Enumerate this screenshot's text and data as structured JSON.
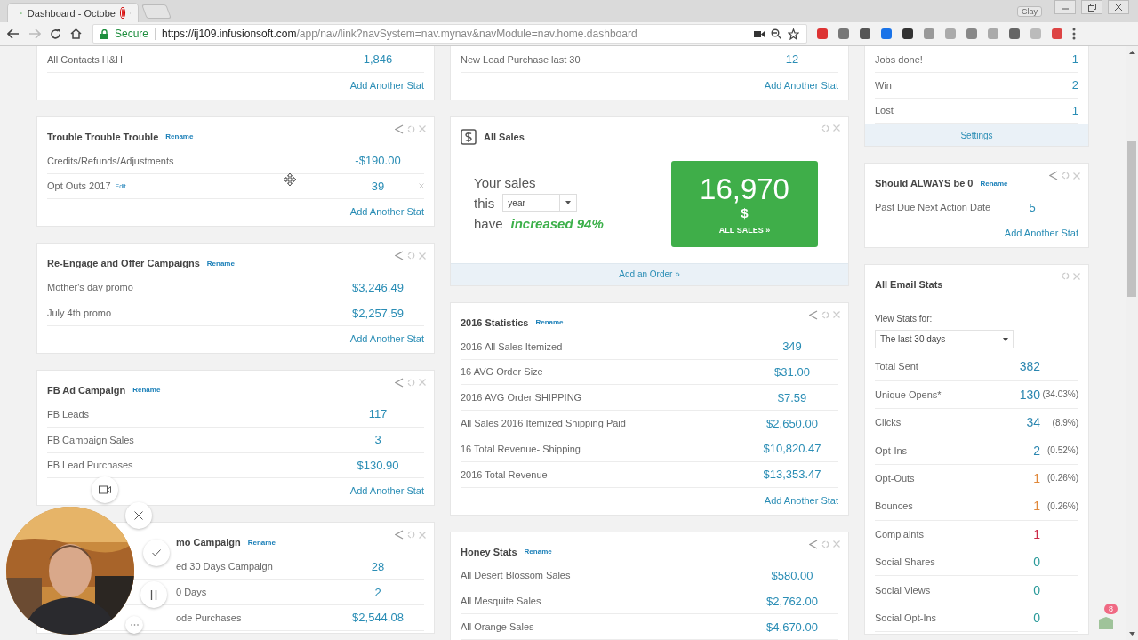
{
  "browser": {
    "tab": {
      "title": "Dashboard - Octobe",
      "recording": true
    },
    "profile": "Clay",
    "secure_label": "Secure",
    "url_host": "https://ij109.infusionsoft.com",
    "url_path": "/app/nav/link?navSystem=nav.mynav&navModule=nav.home.dashboard"
  },
  "columns": [
    {
      "cards": [
        {
          "kind": "stats",
          "rows": [
            {
              "label": "All Contacts H&H",
              "value": "1,846"
            }
          ],
          "add_stat": "Add Another Stat"
        },
        {
          "kind": "stats",
          "title": "Trouble Trouble Trouble",
          "rename": "Rename",
          "shareable": true,
          "rows": [
            {
              "label": "Credits/Refunds/Adjustments",
              "value": "-$190.00",
              "removable": false
            },
            {
              "label": "Opt Outs 2017",
              "edit": "Edit",
              "value": "39",
              "removable": true
            }
          ],
          "add_stat": "Add Another Stat"
        },
        {
          "kind": "stats",
          "title": "Re-Engage and Offer Campaigns",
          "rename": "Rename",
          "shareable": true,
          "rows": [
            {
              "label": "Mother's day promo",
              "value": "$3,246.49"
            },
            {
              "label": "July 4th promo",
              "value": "$2,257.59"
            }
          ],
          "add_stat": "Add Another Stat"
        },
        {
          "kind": "stats",
          "title": "FB Ad Campaign",
          "rename": "Rename",
          "shareable": true,
          "rows": [
            {
              "label": "FB Leads",
              "value": "117"
            },
            {
              "label": "FB Campaign Sales",
              "value": "3"
            },
            {
              "label": "FB Lead Purchases",
              "value": "$130.90"
            }
          ],
          "add_stat": "Add Another Stat"
        },
        {
          "kind": "stats",
          "title": "mo Campaign",
          "rename": "Rename",
          "shareable": true,
          "covered": true,
          "rows": [
            {
              "label": "ed 30 Days Campaign",
              "value": "28"
            },
            {
              "label": "0 Days",
              "value": "2"
            },
            {
              "label": "ode Purchases",
              "value": "$2,544.08"
            }
          ]
        }
      ]
    },
    {
      "cards": [
        {
          "kind": "stats",
          "rows": [
            {
              "label": "New Lead Purchase last 30",
              "value": "12"
            }
          ],
          "add_stat": "Add Another Stat"
        },
        {
          "kind": "sales",
          "title": "All Sales",
          "line_1": "Your sales",
          "line_2": "this",
          "period": "year",
          "line_3": "have",
          "trend": "increased 94%",
          "total": "16,970",
          "currency": "$",
          "all_sales": "ALL SALES »",
          "footer": "Add an Order »"
        },
        {
          "kind": "stats",
          "title": "2016 Statistics",
          "rename": "Rename",
          "shareable": true,
          "rows": [
            {
              "label": "2016 All Sales Itemized",
              "value": "349"
            },
            {
              "label": "16 AVG Order Size",
              "value": "$31.00"
            },
            {
              "label": "2016 AVG Order SHIPPING",
              "value": "$7.59"
            },
            {
              "label": "All Sales 2016 Itemized Shipping Paid",
              "value": "$2,650.00"
            },
            {
              "label": "16 Total Revenue- Shipping",
              "value": "$10,820.47"
            },
            {
              "label": "2016 Total Revenue",
              "value": "$13,353.47"
            }
          ],
          "add_stat": "Add Another Stat"
        },
        {
          "kind": "stats",
          "title": "Honey Stats",
          "rename": "Rename",
          "shareable": true,
          "rows": [
            {
              "label": "All Desert Blossom Sales",
              "value": "$580.00"
            },
            {
              "label": "All Mesquite Sales",
              "value": "$2,762.00"
            },
            {
              "label": "All Orange Sales",
              "value": "$4,670.00"
            }
          ]
        }
      ]
    },
    {
      "cards": [
        {
          "kind": "tally",
          "rows": [
            {
              "label": "Jobs done!",
              "value": "1"
            },
            {
              "label": "Win",
              "value": "2"
            },
            {
              "label": "Lost",
              "value": "1"
            }
          ],
          "footer": "Settings"
        },
        {
          "kind": "stats",
          "title": "Should ALWAYS be 0",
          "rename": "Rename",
          "shareable": true,
          "rows": [
            {
              "label": "Past Due Next Action Date",
              "value": "5"
            }
          ],
          "add_stat": "Add Another Stat"
        },
        {
          "kind": "email",
          "title": "All Email Stats",
          "view_label": "View Stats for:",
          "period": "The last 30 days",
          "rows": [
            {
              "label": "Total Sent",
              "value": "382",
              "color": "#2b86b0"
            },
            {
              "label": "Unique Opens*",
              "value": "130",
              "percent": "(34.03%)",
              "color": "#2b86b0"
            },
            {
              "label": "Clicks",
              "value": "34",
              "percent": "(8.9%)",
              "color": "#2b86b0"
            },
            {
              "label": "Opt-Ins",
              "value": "2",
              "percent": "(0.52%)",
              "color": "#2b86b0"
            },
            {
              "label": "Opt-Outs",
              "value": "1",
              "percent": "(0.26%)",
              "color": "#e0883a"
            },
            {
              "label": "Bounces",
              "value": "1",
              "percent": "(0.26%)",
              "color": "#e0883a"
            },
            {
              "label": "Complaints",
              "value": "1",
              "color": "#cc2a48"
            },
            {
              "label": "Social Shares",
              "value": "0",
              "color": "#2a9a9a"
            },
            {
              "label": "Social Views",
              "value": "0",
              "color": "#2a9a9a"
            },
            {
              "label": "Social Opt-Ins",
              "value": "0",
              "color": "#2a9a9a"
            }
          ]
        }
      ]
    }
  ],
  "chat_badge": "8"
}
